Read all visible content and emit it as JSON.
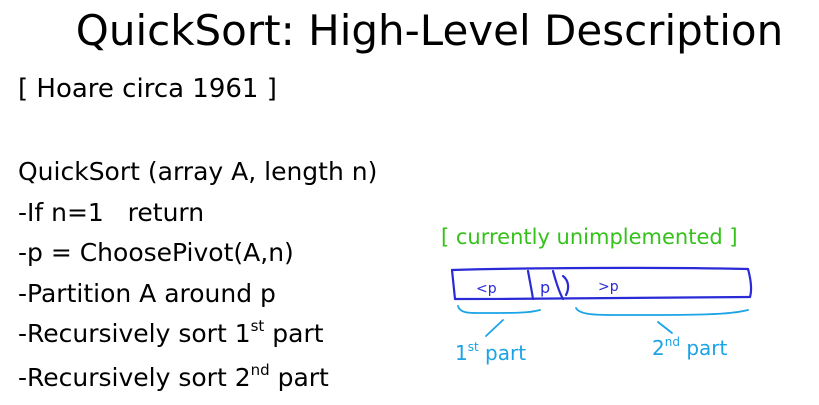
{
  "title": "QuickSort: High-Level Description",
  "subtitle": "[ Hoare circa 1961 ]",
  "code": {
    "signature": "QuickSort (array A, length n)",
    "line_if": "-If n=1   return",
    "line_pivot": "-p = ChoosePivot(A,n)",
    "line_partition": "-Partition A around p",
    "line_sort1_prefix": "-Recursively sort 1",
    "line_sort1_sup": "st",
    "line_sort1_suffix": " part",
    "line_sort2_prefix": "-Recursively sort 2",
    "line_sort2_sup": "nd",
    "line_sort2_suffix": " part"
  },
  "note": "[ currently unimplemented ]",
  "sketch": {
    "less_label": "<p",
    "pivot_label": "p",
    "greater_label": ">p",
    "part1_num": "1",
    "part1_sup": "st",
    "part1_word": " part",
    "part2_num": "2",
    "part2_sup": "nd",
    "part2_word": " part"
  },
  "colors": {
    "note": "#34c21a",
    "ink_blue": "#2a2ad6",
    "ink_cyan": "#1aa3e6"
  }
}
